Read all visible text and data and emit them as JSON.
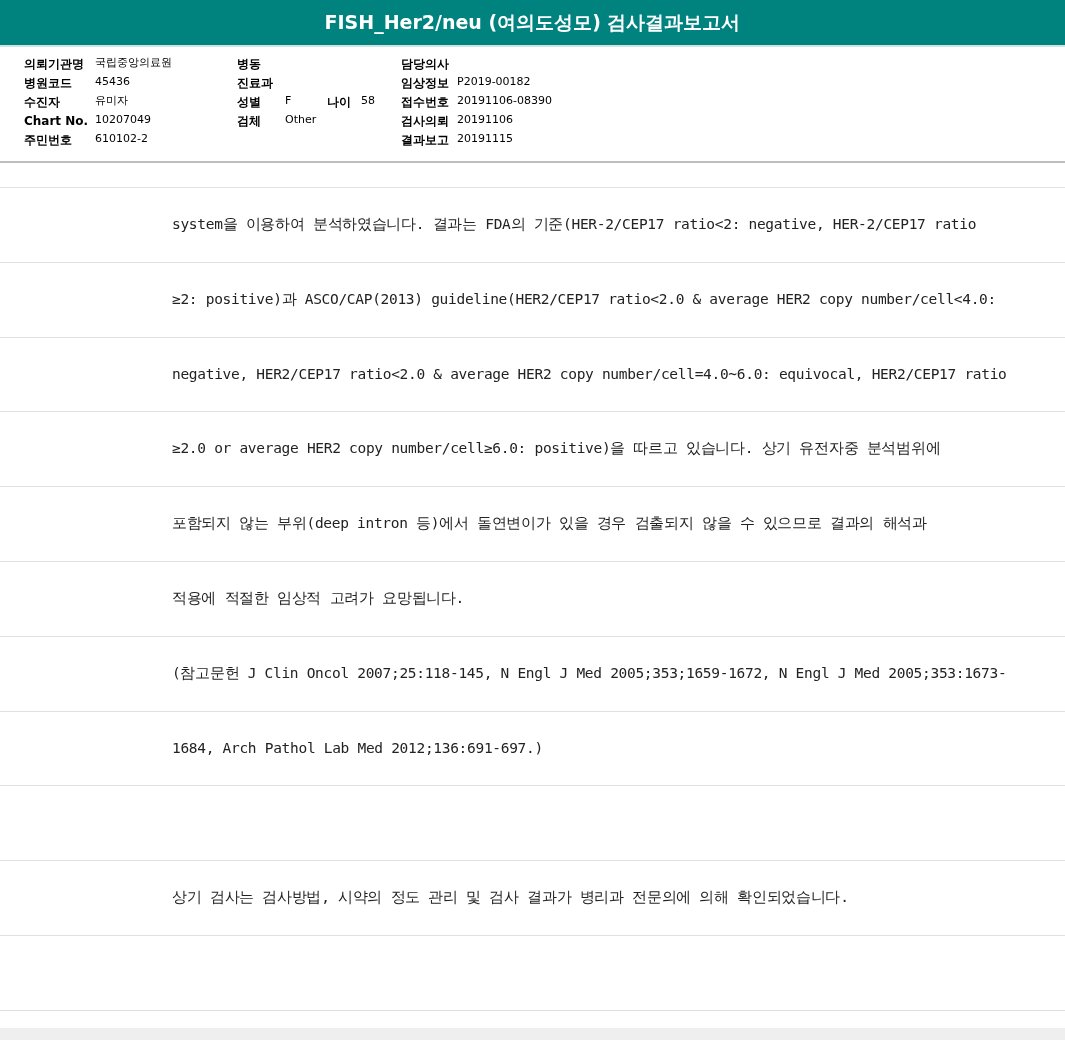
{
  "title": "FISH_Her2/neu (여의도성모) 검사결과보고서",
  "info_rows": [
    {
      "left": {
        "label": "의뢰기관명",
        "value": "국립중앙의료원"
      },
      "middle": {
        "label": "병동"
      },
      "right": {
        "label": "담당의사"
      }
    },
    {
      "left": {
        "label": "병원코드",
        "value": "45436"
      },
      "middle": {
        "label": "진료과"
      },
      "right": {
        "label": "임상정보",
        "value": "P2019-00182"
      }
    },
    {
      "left": {
        "label": "수진자",
        "value": "유미자"
      },
      "middle": {
        "label": "성별",
        "value": "F"
      },
      "extra": {
        "label": "나이",
        "value": "58"
      },
      "right": {
        "label": "접수번호",
        "value": "20191106-08390"
      }
    },
    {
      "left": {
        "label": "Chart No.",
        "value": "10207049"
      },
      "middle": {
        "label": "검체",
        "value": "Other"
      },
      "right": {
        "label": "검사의뢰",
        "value": "20191106"
      }
    },
    {
      "left": {
        "label": "주민번호",
        "value": "610102-2"
      },
      "right": {
        "label": "결과보고",
        "value": "20191115"
      }
    }
  ],
  "report_rows": [
    {
      "kind": "text",
      "text": "system을 이용하여 분석하였습니다. 결과는 FDA의 기준(HER-2/CEP17 ratio<2: negative, HER-2/CEP17 ratio"
    },
    {
      "kind": "text",
      "text": "≥2: positive)과 ASCO/CAP(2013) guideline(HER2/CEP17 ratio<2.0 & average HER2 copy number/cell<4.0:"
    },
    {
      "kind": "text",
      "text": "negative, HER2/CEP17 ratio<2.0 & average HER2 copy number/cell=4.0~6.0: equivocal, HER2/CEP17 ratio"
    },
    {
      "kind": "text",
      "text": "≥2.0 or average HER2 copy number/cell≥6.0: positive)을 따르고 있습니다. 상기 유전자중 분석범위에"
    },
    {
      "kind": "text",
      "text": "포함되지 않는 부위(deep intron 등)에서 돌연변이가 있을 경우 검출되지 않을 수 있으므로 결과의 해석과"
    },
    {
      "kind": "text",
      "text": "적용에 적절한 임상적 고려가 요망됩니다."
    },
    {
      "kind": "text",
      "text": "(참고문헌 J Clin Oncol 2007;25:118-145, N Engl J Med 2005;353;1659-1672, N Engl J Med 2005;353:1673-"
    },
    {
      "kind": "text",
      "text": "1684, Arch Pathol Lab Med 2012;136:691-697.)"
    },
    {
      "kind": "blank"
    },
    {
      "kind": "text",
      "text": "상기 검사는 검사방법, 시약의 정도 관리 및 검사 결과가 병리과 전문의에 의해 확인되었습니다."
    },
    {
      "kind": "blank"
    }
  ]
}
